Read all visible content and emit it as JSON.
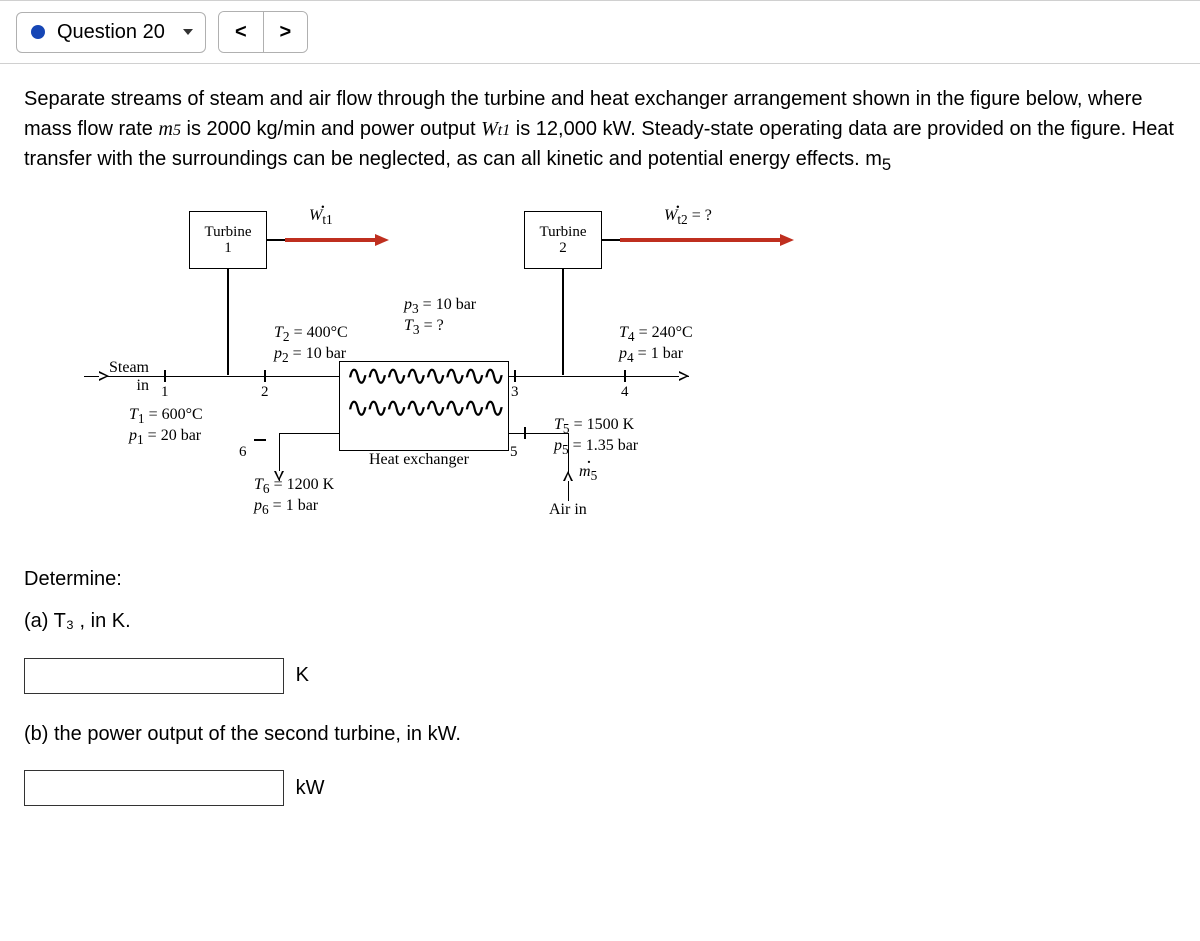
{
  "header": {
    "question_label": "Question 20",
    "prev": "<",
    "next": ">"
  },
  "prompt": {
    "p1a": "Separate streams of steam and air flow through the turbine and heat exchanger arrangement shown in the",
    "p1b": "figure below, where mass flow rate ",
    "m5": "ṁ5",
    "p1c": " is 2000 kg/min and power output ",
    "wt1": "Ẇt1",
    "p1d": " is 12,000 kW. Steady-state operating data are provided on the figure. Heat transfer with the surroundings can be neglected, as can all kinetic and potential energy effects. m",
    "sub5": "5"
  },
  "figure": {
    "turbine1": "Turbine\n1",
    "turbine2": "Turbine\n2",
    "Wt1": "Ẇt1",
    "Wt2": "Ẇt2 = ?",
    "steam_in": "Steam\nin",
    "T1": "T₁ = 600°C",
    "p1": "p₁ = 20 bar",
    "T2": "T₂ = 400°C",
    "p2": "p₂ = 10 bar",
    "p3": "p₃ = 10 bar",
    "T3": "T₃ = ?",
    "T4": "T₄ = 240°C",
    "p4": "p₄ = 1 bar",
    "T5": "T₅ = 1500 K",
    "p5": "p₅ = 1.35 bar",
    "T6": "T₆ = 1200 K",
    "p6": "p₆ = 1 bar",
    "m5": "ṁ₅",
    "air_in": "Air in",
    "hex": "Heat exchanger",
    "n1": "1",
    "n2": "2",
    "n3": "3",
    "n4": "4",
    "n5": "5",
    "n6": "6"
  },
  "questions": {
    "determine": "Determine:",
    "a": "(a) T₃ , in K.",
    "unit_a": "K",
    "b": "(b) the power output of the second turbine, in kW.",
    "unit_b": "kW"
  }
}
